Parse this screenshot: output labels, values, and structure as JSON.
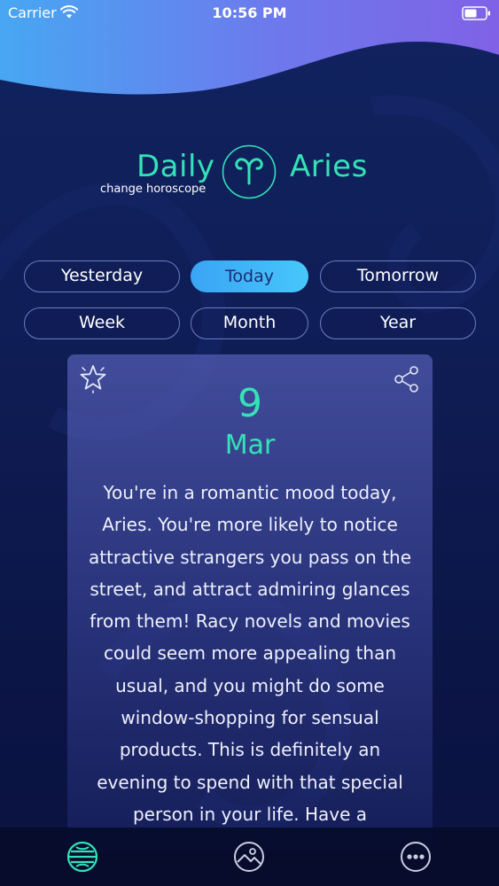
{
  "status_bar": {
    "carrier": "Carrier",
    "time": "10:56 PM",
    "icons": [
      "wifi-icon",
      "battery-icon"
    ]
  },
  "header": {
    "title_left": "Daily",
    "title_right": "Aries",
    "subtitle": "change horoscope",
    "emblem_icon": "aries-symbol-icon"
  },
  "periods": [
    {
      "label": "Yesterday",
      "active": false
    },
    {
      "label": "Today",
      "active": true
    },
    {
      "label": "Tomorrow",
      "active": false
    },
    {
      "label": "Week",
      "active": false
    },
    {
      "label": "Month",
      "active": false
    },
    {
      "label": "Year",
      "active": false
    }
  ],
  "card": {
    "day": "9",
    "month": "Mar",
    "text_lines": [
      "You're in a romantic mood today,",
      "Aries. You're more likely to notice",
      "attractive strangers you pass on the",
      "street, and attract admiring glances",
      "from them! Racy novels and movies",
      "could seem more appealing than",
      "usual, and you might do some",
      "window-shopping for sensual",
      "products. This is definitely an",
      "evening to spend with that special",
      "person in your life. Have a"
    ],
    "icons": [
      "favorite-star-icon",
      "share-icon"
    ]
  },
  "tab_bar": {
    "tabs": [
      {
        "name": "horoscope",
        "icon": "horoscope-globe-icon",
        "active": true
      },
      {
        "name": "gallery",
        "icon": "image-icon",
        "active": false
      },
      {
        "name": "more",
        "icon": "more-dots-icon",
        "active": false
      }
    ]
  },
  "colors": {
    "accent": "#34e2b7",
    "active_button": "#3aa4f5",
    "background": "#0f1d55",
    "card": "#525cb2"
  }
}
